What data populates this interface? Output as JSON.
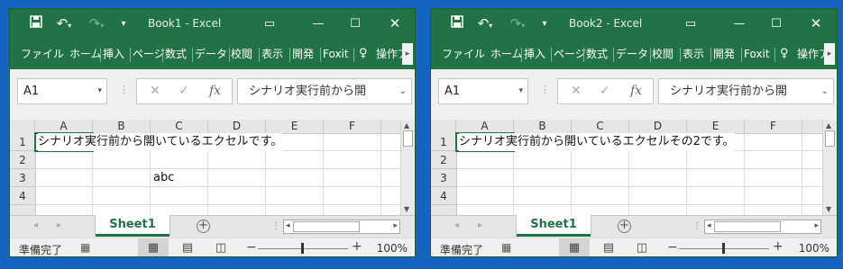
{
  "windows": [
    {
      "title": "Book1 - Excel",
      "ribbon_tabs": [
        "ファイル",
        "ホーム",
        "挿入",
        "ページ",
        "数式",
        "データ",
        "校閲",
        "表示",
        "開発",
        "Foxit",
        "操作ア"
      ],
      "name_box": "A1",
      "formula_content": "シナリオ実行前から開",
      "columns": [
        "A",
        "B",
        "C",
        "D",
        "E",
        "F"
      ],
      "rows": [
        "1",
        "2",
        "3",
        "4"
      ],
      "cells": [
        {
          "ref": "A1",
          "value": "シナリオ実行前から開いているエクセルです。"
        },
        {
          "ref": "C3",
          "value": "abc"
        }
      ],
      "sheet_tab": "Sheet1",
      "status": "準備完了",
      "zoom": "100%"
    },
    {
      "title": "Book2 - Excel",
      "ribbon_tabs": [
        "ファイル",
        "ホーム",
        "挿入",
        "ページ",
        "数式",
        "データ",
        "校閲",
        "表示",
        "開発",
        "Foxit",
        "操作ア"
      ],
      "name_box": "A1",
      "formula_content": "シナリオ実行前から開",
      "columns": [
        "A",
        "B",
        "C",
        "D",
        "E",
        "F"
      ],
      "rows": [
        "1",
        "2",
        "3",
        "4"
      ],
      "cells": [
        {
          "ref": "A1",
          "value": "シナリオ実行前から開いているエクセルその2です。"
        }
      ],
      "sheet_tab": "Sheet1",
      "status": "準備完了",
      "zoom": "100%"
    }
  ],
  "icons": {
    "save": "save-icon",
    "undo": "undo-icon",
    "redo": "redo-icon",
    "customize": "customize-qat-icon",
    "ribbon_display": "ribbon-display-options-icon",
    "minimize": "minimize-icon",
    "maximize": "maximize-icon",
    "close": "close-icon",
    "lightbulb": "lightbulb-icon"
  },
  "colors": {
    "excel_green": "#217346",
    "desktop": "#1565c0"
  }
}
